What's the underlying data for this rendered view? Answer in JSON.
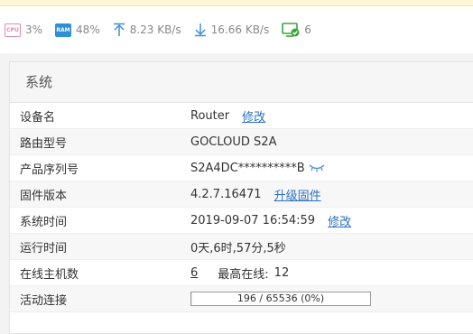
{
  "status": {
    "cpu": {
      "icon": "cpu-icon",
      "label": "CPU",
      "value": "3%"
    },
    "ram": {
      "icon": "ram-icon",
      "label": "RAM",
      "value": "48%"
    },
    "upload": {
      "icon": "upload-arrow-icon",
      "value": "8.23 KB/s"
    },
    "download": {
      "icon": "download-arrow-icon",
      "value": "16.66 KB/s"
    },
    "clients": {
      "icon": "monitor-check-icon",
      "value": "6"
    }
  },
  "colors": {
    "accent": "#2a6fc4",
    "ram_chip": "#2f8fd8",
    "cpu_chip": "#e38aa6",
    "status_text": "#888888"
  },
  "panel": {
    "title": "系统",
    "rows": {
      "device_name": {
        "label": "设备名",
        "value": "Router",
        "action": "修改"
      },
      "model": {
        "label": "路由型号",
        "value": "GOCLOUD S2A"
      },
      "serial": {
        "label": "产品序列号",
        "value": "S2A4DC**********B"
      },
      "firmware": {
        "label": "固件版本",
        "value": "4.2.7.16471",
        "action": "升级固件"
      },
      "system_time": {
        "label": "系统时间",
        "value": "2019-09-07 16:54:59",
        "action": "修改"
      },
      "uptime": {
        "label": "运行时间",
        "value": "0天,6时,57分,5秒"
      },
      "online_hosts": {
        "label": "在线主机数",
        "value": "6",
        "peak_label": "最高在线:",
        "peak_value": "12"
      },
      "connections": {
        "label": "活动连接",
        "value": "196 / 65536 (0%)",
        "fraction": 0.003
      }
    }
  }
}
